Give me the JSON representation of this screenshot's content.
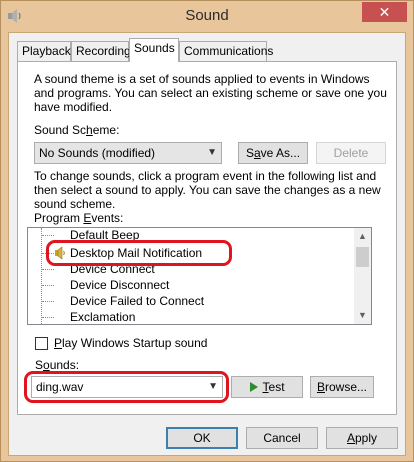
{
  "window": {
    "title": "Sound",
    "close_glyph": "✕"
  },
  "tabs": [
    {
      "label": "Playback"
    },
    {
      "label": "Recording"
    },
    {
      "label": "Sounds"
    },
    {
      "label": "Communications"
    }
  ],
  "sounds_tab": {
    "intro": [
      "A sound theme is a set of sounds applied to events in Windows",
      "and programs.  You can select an existing scheme or save one you",
      "have modified."
    ],
    "scheme_label_pre": "Sound Sc",
    "scheme_label_key": "h",
    "scheme_label_post": "eme:",
    "scheme_value": "No Sounds (modified)",
    "save_as_pre": "S",
    "save_as_key": "a",
    "save_as_post": "ve As...",
    "delete_label": "Delete",
    "instructions": [
      "To change sounds, click a program event in the following list and",
      "then select a sound to apply.  You can save the changes as a new",
      "sound scheme."
    ],
    "program_events_pre": "Program ",
    "program_events_key": "E",
    "program_events_post": "vents:",
    "events": [
      {
        "label": "Default Beep"
      },
      {
        "label": "Desktop Mail Notification",
        "selected": true,
        "icon": "speaker-icon"
      },
      {
        "label": "Device Connect"
      },
      {
        "label": "Device Disconnect"
      },
      {
        "label": "Device Failed to Connect"
      },
      {
        "label": "Exclamation"
      }
    ],
    "startup_checkbox": {
      "checked": false,
      "label_pre": "",
      "label_key": "P",
      "label_post": "lay Windows Startup sound"
    },
    "sounds_label_pre": "S",
    "sounds_label_key": "o",
    "sounds_label_post": "unds:",
    "sound_value": "ding.wav",
    "test_key": "T",
    "test_post": "est",
    "browse_pre": "",
    "browse_key": "B",
    "browse_post": "rowse..."
  },
  "footer": {
    "ok": "OK",
    "cancel": "Cancel",
    "apply_key": "A",
    "apply_post": "pply"
  },
  "colors": {
    "annotation": "#e0141e",
    "title_bar": "#e8c59a",
    "play_arrow": "#2e8b2e"
  }
}
